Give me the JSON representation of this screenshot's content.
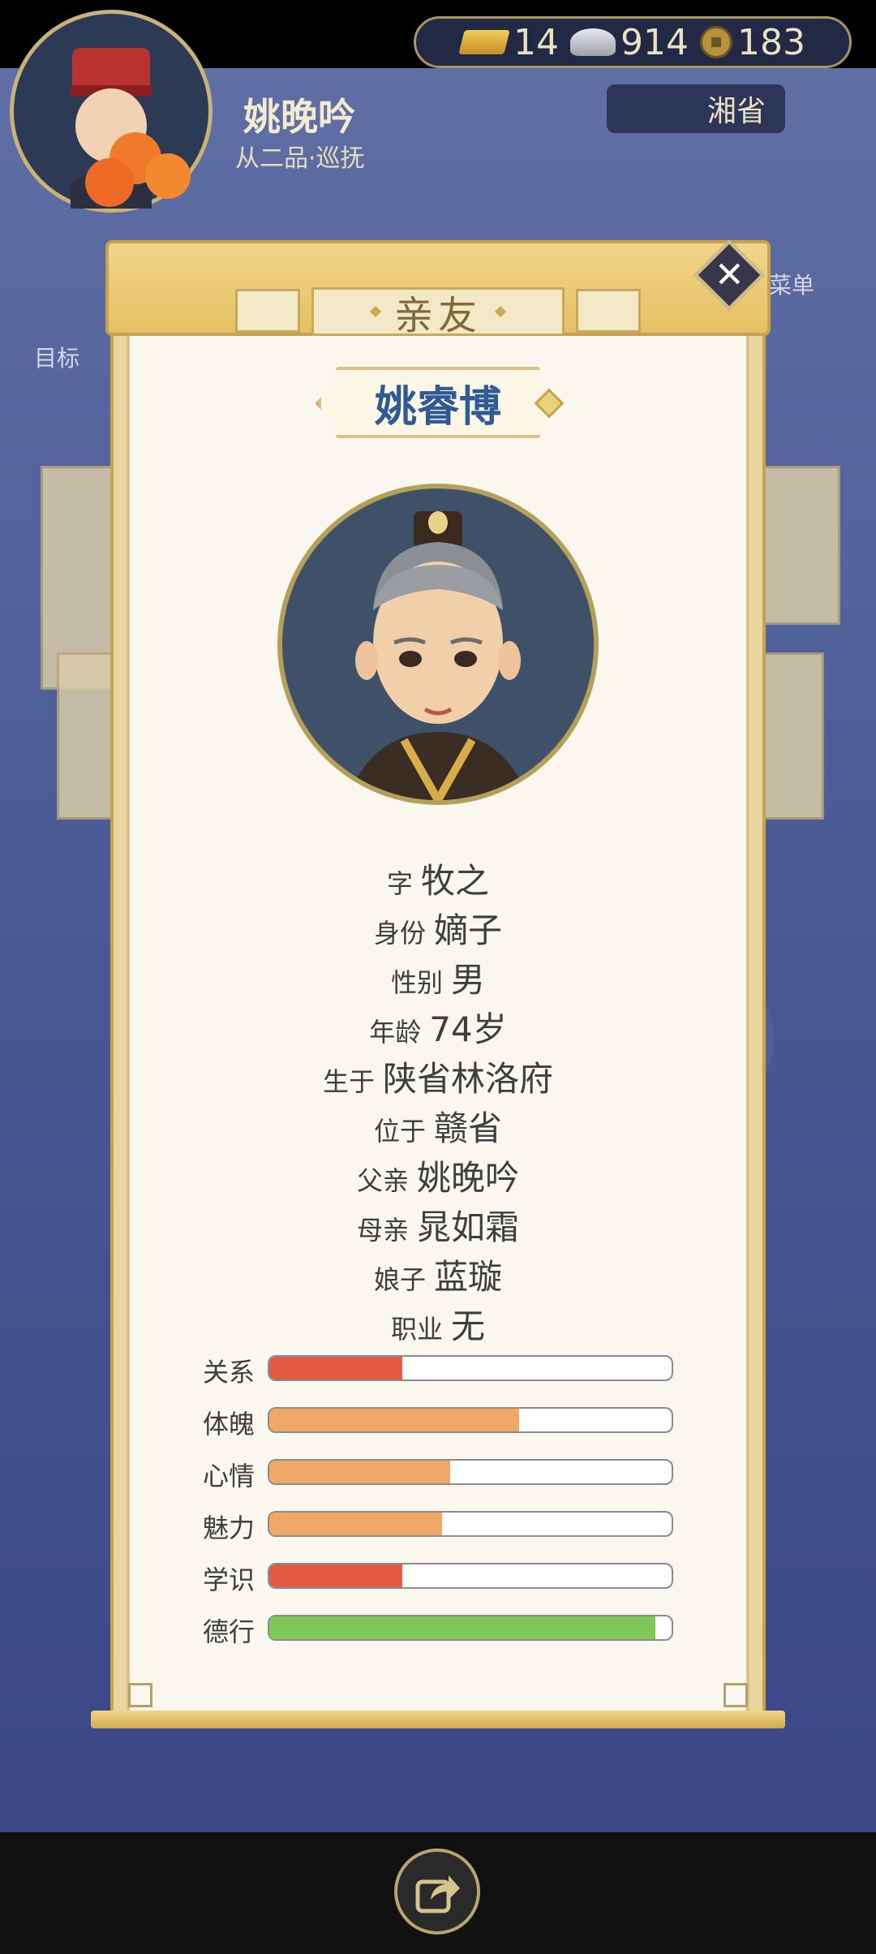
{
  "player": {
    "name": "姚晚吟",
    "title": "从二品·巡抚",
    "goal_label": "目标"
  },
  "currency": {
    "gold": "14",
    "silver": "914",
    "coins": "183"
  },
  "region": "湘省",
  "menu_label": "菜单",
  "panel": {
    "tab_title": "亲友",
    "person_name": "姚睿博",
    "info": [
      {
        "key": "字",
        "value": "牧之"
      },
      {
        "key": "身份",
        "value": "嫡子"
      },
      {
        "key": "性别",
        "value": "男"
      },
      {
        "key": "年龄",
        "value": "74岁"
      },
      {
        "key": "生于",
        "value": "陕省林洛府"
      },
      {
        "key": "位于",
        "value": "赣省"
      },
      {
        "key": "父亲",
        "value": "姚晚吟"
      },
      {
        "key": "母亲",
        "value": "晁如霜"
      },
      {
        "key": "娘子",
        "value": "蓝璇"
      },
      {
        "key": "职业",
        "value": "无"
      }
    ],
    "stats": [
      {
        "label": "关系",
        "fraction": 0.33,
        "color": "#e35a44"
      },
      {
        "label": "体魄",
        "fraction": 0.62,
        "color": "#f0a866"
      },
      {
        "label": "心情",
        "fraction": 0.45,
        "color": "#f0a866"
      },
      {
        "label": "魅力",
        "fraction": 0.43,
        "color": "#f0a866"
      },
      {
        "label": "学识",
        "fraction": 0.33,
        "color": "#e35a44"
      },
      {
        "label": "德行",
        "fraction": 0.96,
        "color": "#7ec85a"
      }
    ]
  }
}
